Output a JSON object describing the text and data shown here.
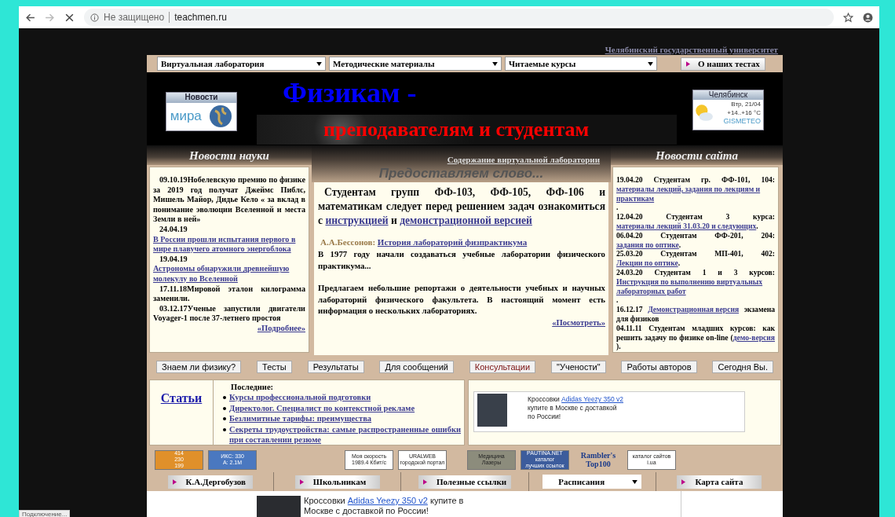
{
  "browser": {
    "security": "Не защищено",
    "url": "teachmen.ru"
  },
  "university_link": "Челябинский государственный университет",
  "menu": {
    "selects": [
      "Виртуальная лаборатория",
      "Методические материалы",
      "Читаемые курсы"
    ],
    "button": "О наших тестах"
  },
  "header": {
    "news_logo": {
      "label": "Новости",
      "word": "мира"
    },
    "title": "Физикам -",
    "subtitle": "преподавателям и студентам",
    "weather": {
      "city": "Челябинск",
      "date": "Втр, 21/04",
      "temp": "+14..+16 °C",
      "brand": "GISMETEO"
    }
  },
  "science_news": {
    "title": "Новости науки",
    "items": [
      {
        "date": "09.10.19",
        "parts": [
          {
            "text": "Нобелевскую премию по физике за 2019 год получат Джеймс Пиблс, Мишель Майор, Дидье Кело « за вклад в понимание эволюции Вселенной и места Земли в ней»",
            "link": false
          }
        ]
      },
      {
        "date": "24.04.19",
        "parts": [
          {
            "text": "В России прошли испытания первого в мире плавучего атомного энергоблока",
            "link": true
          }
        ]
      },
      {
        "date": "19.04.19",
        "parts": [
          {
            "text": "Астрономы обнаружили древнейшую молекулу во Вселенной",
            "link": true
          }
        ]
      },
      {
        "date": "17.11.18",
        "parts": [
          {
            "text": "Мировой эталон килограмма заменили.",
            "link": false
          }
        ]
      },
      {
        "date": "03.12.17",
        "parts": [
          {
            "text": "Ученые запустили двигатели Voyager-1 после 37-летнего простоя",
            "link": false
          }
        ]
      }
    ],
    "more": "«Подробнее»"
  },
  "center": {
    "link": "Содержание виртуальной лаборатории",
    "title": "Предоставляем слово...",
    "intro": [
      {
        "text": "Студентам групп ФФ-103, ФФ-105, ФФ-106 и математикам следует перед решением задач ознакомиться с ",
        "link": false
      },
      {
        "text": "инструкцией",
        "link": true
      },
      {
        "text": " и ",
        "link": false
      },
      {
        "text": "демонстрационной версией",
        "link": true
      }
    ],
    "author": "А.А.Бессонов:",
    "article_link": "История лабораторий физпрактикума",
    "paragraphs": [
      "В 1977 году начали создаваться учебные лаборатории физического практикума...",
      "Предлагаем небольшие репортажи о деятельности учебных и научных лабораторий физического факультета. В настоящий момент есть информация о нескольких лабораториях."
    ],
    "more": "«Посмотреть»"
  },
  "site_news": {
    "title": "Новости сайта",
    "items": [
      {
        "date": "19.04.20",
        "parts": [
          {
            "text": "Студентам гр. ФФ-101, 104: ",
            "link": false
          },
          {
            "text": "материалы лекций, задания по лекциям и практикам",
            "link": true
          },
          {
            "text": ".",
            "link": false
          }
        ]
      },
      {
        "date": "12.04.20",
        "parts": [
          {
            "text": "Студентам 3 курса: ",
            "link": false
          },
          {
            "text": "материалы лекций 31.03.20 и следующих",
            "link": true
          },
          {
            "text": ".",
            "link": false
          }
        ]
      },
      {
        "date": "06.04.20",
        "parts": [
          {
            "text": "Студентам ФФ-201, 204: ",
            "link": false
          },
          {
            "text": "задания по оптике",
            "link": true
          },
          {
            "text": ".",
            "link": false
          }
        ]
      },
      {
        "date": "25.03.20",
        "parts": [
          {
            "text": "Студентам МП-401, 402: ",
            "link": false
          },
          {
            "text": "Лекции по оптике",
            "link": true
          },
          {
            "text": ".",
            "link": false
          }
        ]
      },
      {
        "date": "24.03.20",
        "parts": [
          {
            "text": "Студентам 1 и 3 курсов: ",
            "link": false
          },
          {
            "text": "Инструкция по выполнению виртуальных лабораторных работ",
            "link": true
          },
          {
            "text": ".",
            "link": false
          }
        ]
      },
      {
        "date": "16.12.17",
        "parts": [
          {
            "text": "Демонстрационная версия",
            "link": true
          },
          {
            "text": " экзамена для физиков",
            "link": false
          }
        ]
      },
      {
        "date": "04.11.11",
        "parts": [
          {
            "text": "Студентам младших курсов: как решить задачу по физике on-line (",
            "link": false
          },
          {
            "text": "демо-версия",
            "link": true
          },
          {
            "text": ").",
            "link": false
          }
        ]
      }
    ]
  },
  "buttons": [
    {
      "label": "Знаем ли физику?",
      "highlighted": false
    },
    {
      "label": "Тесты",
      "highlighted": false
    },
    {
      "label": "Результаты",
      "highlighted": false
    },
    {
      "label": "Для сообщений",
      "highlighted": false
    },
    {
      "label": "Консультации",
      "highlighted": true
    },
    {
      "label": "\"Учености\"",
      "highlighted": false
    },
    {
      "label": "Работы авторов",
      "highlighted": false
    },
    {
      "label": "Сегодня Вы.",
      "highlighted": false
    }
  ],
  "articles": {
    "title": "Статьи",
    "heading": "Последние:",
    "items": [
      "Курсы профессиональной подготовки",
      "Директолог. Специалист по контекстной рекламе",
      "Безлимитные тарифы: преимущества",
      "Секреты трудоустройства: самые распространенные ошибки при составлении резюме"
    ]
  },
  "ad": {
    "before": "Кроссовки ",
    "link": "Adidas Yeezy 350 v2",
    "after": " купите в Москве с доставкой по России!"
  },
  "counters": [
    {
      "kind": "dark",
      "color": "#e0902a",
      "lines": [
        "414",
        "230",
        "199"
      ]
    },
    {
      "kind": "dark",
      "color": "#4a78c0",
      "lines": [
        "ИКС: 330",
        "А: 2.1M"
      ]
    },
    {
      "kind": "light",
      "color": "#ffffff",
      "lines": [
        "Моя скорость",
        "1989.4 Кбит/с"
      ]
    },
    {
      "kind": "light",
      "color": "#ffffff",
      "lines": [
        "URALWEB",
        "городской портал"
      ]
    },
    {
      "kind": "light",
      "color": "#8c8c7c",
      "lines": [
        "Медицина",
        "Лазеры"
      ]
    },
    {
      "kind": "dark",
      "color": "#3c5c9c",
      "lines": [
        "PAUTINA.NET",
        "каталог",
        "лучших ссылок"
      ]
    },
    {
      "kind": "plain",
      "color": "#d2b9a0",
      "lines": [
        "Rambler's",
        "Top100"
      ]
    },
    {
      "kind": "light",
      "color": "#ffffff",
      "lines": [
        "каталог сайтов",
        "i.ua"
      ]
    }
  ],
  "nav": [
    {
      "kind": "button",
      "label": "К.А.Дергобузов"
    },
    {
      "kind": "button",
      "label": "Школьникам"
    },
    {
      "kind": "button",
      "label": "Полезные ссылки"
    },
    {
      "kind": "select",
      "label": "Расписания"
    },
    {
      "kind": "button",
      "label": "Карта сайта"
    }
  ],
  "bottom_ad": {
    "before": "Кроссовки ",
    "link": "Adidas Yeezy 350 v2",
    "after": " купите в Москве с доставкой по России!"
  },
  "status": "Подключение..."
}
